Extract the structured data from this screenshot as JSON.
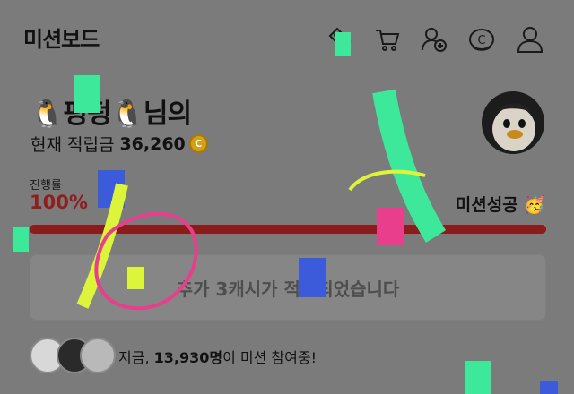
{
  "header": {
    "title": "미션보드",
    "icons": [
      "coupon-icon",
      "cart-icon",
      "add-friend-icon",
      "coin-icon",
      "profile-icon"
    ]
  },
  "user": {
    "name_label": "🐧펑펑🐧님의",
    "points_label": "현재 적립금",
    "points_value": "36,260",
    "coin_symbol": "C"
  },
  "progress": {
    "label": "진행률",
    "value_text": "100%",
    "value": 100,
    "status": "미션성공 🥳",
    "color": "#8a1c1c"
  },
  "reward": {
    "message": "추가 3캐시가 적립되었습니다"
  },
  "participants": {
    "prefix": "지금, ",
    "count": "13,930명",
    "suffix": "이 미션 참여중!"
  },
  "colors": {
    "overlay": "#7b7b7b",
    "confetti_green": "#3ee89a",
    "confetti_yellow": "#dcf53a",
    "confetti_blue": "#3b5bdb",
    "confetti_pink": "#e83e8c"
  }
}
